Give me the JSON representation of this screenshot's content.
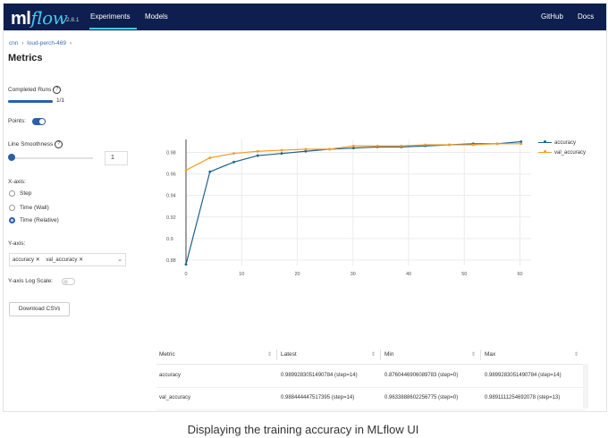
{
  "app": {
    "logo_ml": "ml",
    "logo_flow": "flow",
    "version": "2.8.1",
    "nav": {
      "experiments": "Experiments",
      "models": "Models",
      "github": "GitHub",
      "docs": "Docs"
    }
  },
  "breadcrumb": {
    "item1": "cnn",
    "sep": "›",
    "item2": "loud-perch-469",
    "sep2": "›"
  },
  "page_title": "Metrics",
  "controls": {
    "completed_runs_label": "Completed Runs",
    "completed_runs_value": "1/1",
    "completed_runs_fraction": 1.0,
    "points_label": "Points:",
    "line_smoothness_label": "Line Smoothness",
    "line_smoothness_value": "1",
    "xaxis_label": "X-axis:",
    "xaxis_options": [
      "Step",
      "Time (Wall)",
      "Time (Relative)"
    ],
    "xaxis_selected": "Time (Relative)",
    "yaxis_label": "Y-axis:",
    "yaxis_tags": [
      "accuracy",
      "val_accuracy"
    ],
    "tag_remove": "✕",
    "ylog_label": "Y-axis Log Scale:",
    "download_label": "Download CSV"
  },
  "chart_data": {
    "type": "line",
    "title": "",
    "xlabel": "",
    "ylabel": "",
    "xlim": [
      0,
      62
    ],
    "ylim": [
      0.875,
      0.992
    ],
    "xticks": [
      0,
      10,
      20,
      30,
      40,
      50,
      60
    ],
    "yticks": [
      0.88,
      0.9,
      0.92,
      0.94,
      0.96,
      0.98
    ],
    "ytick_labels": [
      "0.88",
      "0.9",
      "0.92",
      "0.94",
      "0.96",
      "0.98"
    ],
    "grid": true,
    "legend": "top-right",
    "series": [
      {
        "name": "accuracy",
        "color": "#1f5f8b",
        "x": [
          0,
          4.3,
          8.6,
          12.9,
          17.2,
          21.5,
          25.8,
          30.1,
          34.4,
          38.7,
          43.0,
          47.3,
          51.6,
          55.9,
          60.2
        ],
        "y": [
          0.876,
          0.962,
          0.971,
          0.977,
          0.979,
          0.981,
          0.983,
          0.984,
          0.985,
          0.985,
          0.986,
          0.987,
          0.988,
          0.988,
          0.9899
        ]
      },
      {
        "name": "val_accuracy",
        "color": "#f29d28",
        "x": [
          0,
          4.3,
          8.6,
          12.9,
          17.2,
          21.5,
          25.8,
          30.1,
          34.4,
          38.7,
          43.0,
          47.3,
          51.6,
          55.9,
          60.2
        ],
        "y": [
          0.9634,
          0.975,
          0.979,
          0.981,
          0.982,
          0.983,
          0.983,
          0.986,
          0.986,
          0.986,
          0.987,
          0.987,
          0.987,
          0.988,
          0.988
        ]
      }
    ]
  },
  "table": {
    "headers": [
      "Metric",
      "Latest",
      "Min",
      "Max"
    ],
    "rows": [
      {
        "metric": "accuracy",
        "latest": "0.9899283051490784 (step=14)",
        "min": "0.8760446906089783 (step=0)",
        "max": "0.9899283051490784 (step=14)"
      },
      {
        "metric": "val_accuracy",
        "latest": "0.988444447517395 (step=14)",
        "min": "0.9633888602256775 (step=0)",
        "max": "0.9891111254692078 (step=13)"
      }
    ]
  },
  "caption": "Displaying the training accuracy in MLflow UI"
}
